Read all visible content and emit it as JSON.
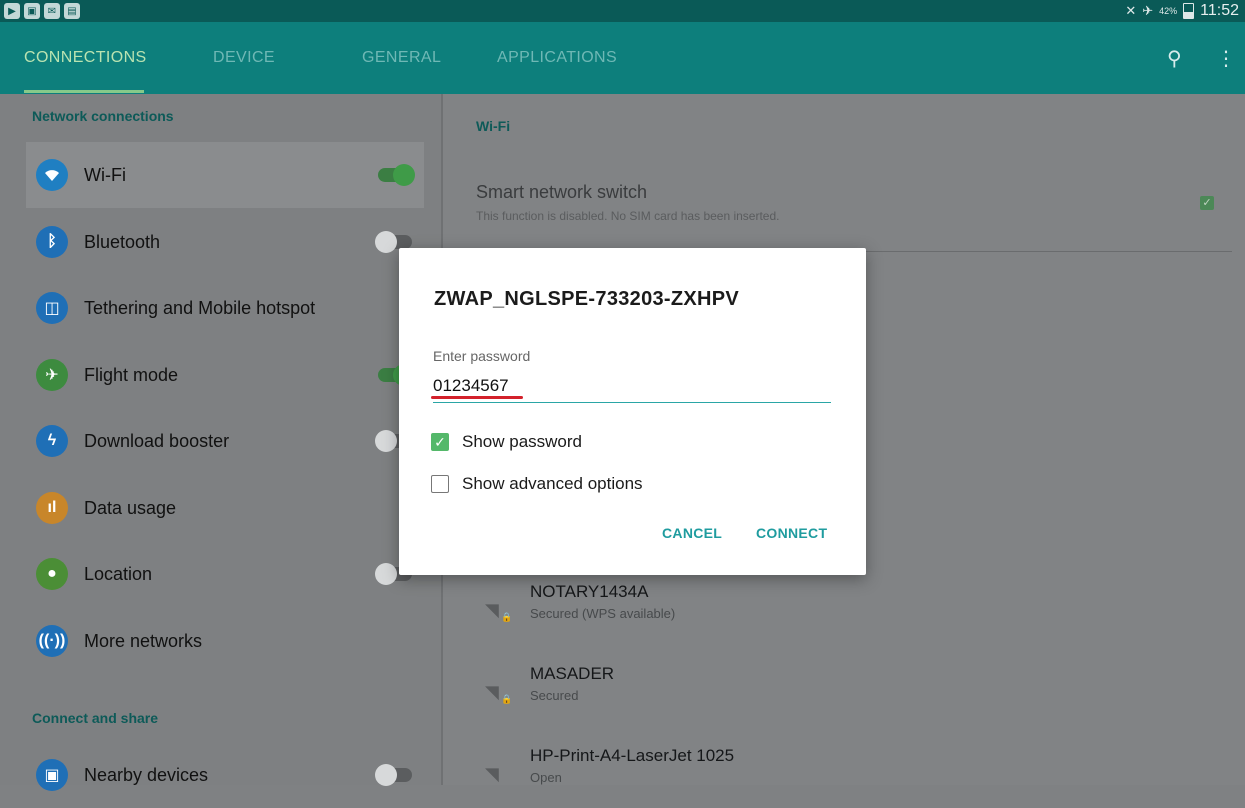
{
  "status_bar": {
    "battery": "42%",
    "time": "11:52",
    "icons_left": [
      "youtube-notification-icon",
      "gallery-notification-icon",
      "email-notification-icon",
      "screenshot-notification-icon"
    ]
  },
  "tabs": [
    {
      "label": "CONNECTIONS",
      "active": true
    },
    {
      "label": "DEVICE",
      "active": false
    },
    {
      "label": "GENERAL",
      "active": false
    },
    {
      "label": "APPLICATIONS",
      "active": false
    }
  ],
  "sidebar": {
    "section_network": "Network connections",
    "items": [
      {
        "label": "Wi-Fi",
        "icon": "wifi-icon",
        "toggle": "on",
        "selected": true
      },
      {
        "label": "Bluetooth",
        "icon": "bluetooth-icon",
        "toggle": "off"
      },
      {
        "label": "Tethering and Mobile hotspot",
        "icon": "hotspot-icon",
        "toggle": "none"
      },
      {
        "label": "Flight mode",
        "icon": "airplane-icon",
        "toggle": "on"
      },
      {
        "label": "Download booster",
        "icon": "bolt-icon",
        "toggle": "off"
      },
      {
        "label": "Data usage",
        "icon": "chart-icon",
        "toggle": "none"
      },
      {
        "label": "Location",
        "icon": "location-icon",
        "toggle": "off"
      },
      {
        "label": "More networks",
        "icon": "antenna-icon",
        "toggle": "none"
      }
    ],
    "section_connect": "Connect and share",
    "connect_items": [
      {
        "label": "Nearby devices",
        "icon": "nearby-devices-icon",
        "toggle": "off"
      }
    ]
  },
  "main": {
    "heading": "Wi-Fi",
    "smart_switch": {
      "title": "Smart network switch",
      "subtitle": "This function is disabled. No SIM card has been inserted."
    },
    "networks": [
      {
        "name": "NOTARY1434A",
        "status": "Secured (WPS available)",
        "secured": true
      },
      {
        "name": "MASADER",
        "status": "Secured",
        "secured": true
      },
      {
        "name": "HP-Print-A4-LaserJet 1025",
        "status": "Open",
        "secured": false
      }
    ]
  },
  "dialog": {
    "title": "ZWAP_NGLSPE-733203-ZXHPV",
    "password_label": "Enter password",
    "password_value": "01234567",
    "show_password": "Show password",
    "show_advanced": "Show advanced options",
    "cancel": "CANCEL",
    "connect": "CONNECT"
  },
  "colors": {
    "status_bar": "#0a5a57",
    "tab_bar": "#0d7f7c",
    "accent": "#1f9c9f",
    "toggle_on": "#3f9b48",
    "password_highlight": "#d3212b"
  }
}
